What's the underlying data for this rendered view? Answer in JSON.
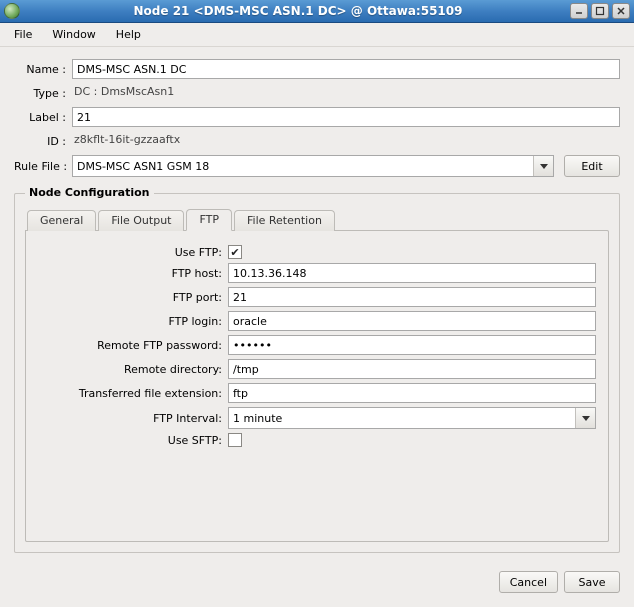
{
  "window": {
    "title": "Node 21 <DMS-MSC ASN.1 DC> @ Ottawa:55109"
  },
  "menu": {
    "file": "File",
    "window": "Window",
    "help": "Help"
  },
  "form": {
    "name_label": "Name :",
    "name_value": "DMS-MSC ASN.1 DC",
    "type_label": "Type :",
    "type_value": "DC : DmsMscAsn1",
    "label_label": "Label :",
    "label_value": "21",
    "id_label": "ID :",
    "id_value": "z8kflt-16it-gzzaaftx",
    "rulefile_label": "Rule File :",
    "rulefile_value": "DMS-MSC ASN1 GSM 18",
    "edit_label": "Edit"
  },
  "fieldset": {
    "legend": "Node Configuration"
  },
  "tabs": {
    "general": "General",
    "file_output": "File Output",
    "ftp": "FTP",
    "file_retention": "File Retention",
    "active": "ftp"
  },
  "ftp": {
    "use_ftp_label": "Use FTP:",
    "use_ftp_checked": true,
    "host_label": "FTP host:",
    "host_value": "10.13.36.148",
    "port_label": "FTP port:",
    "port_value": "21",
    "login_label": "FTP login:",
    "login_value": "oracle",
    "password_label": "Remote FTP password:",
    "password_value": "••••••",
    "remote_dir_label": "Remote directory:",
    "remote_dir_value": "/tmp",
    "ext_label": "Transferred file extension:",
    "ext_value": "ftp",
    "interval_label": "FTP Interval:",
    "interval_value": "1 minute",
    "use_sftp_label": "Use SFTP:",
    "use_sftp_checked": false
  },
  "buttons": {
    "cancel": "Cancel",
    "save": "Save"
  }
}
